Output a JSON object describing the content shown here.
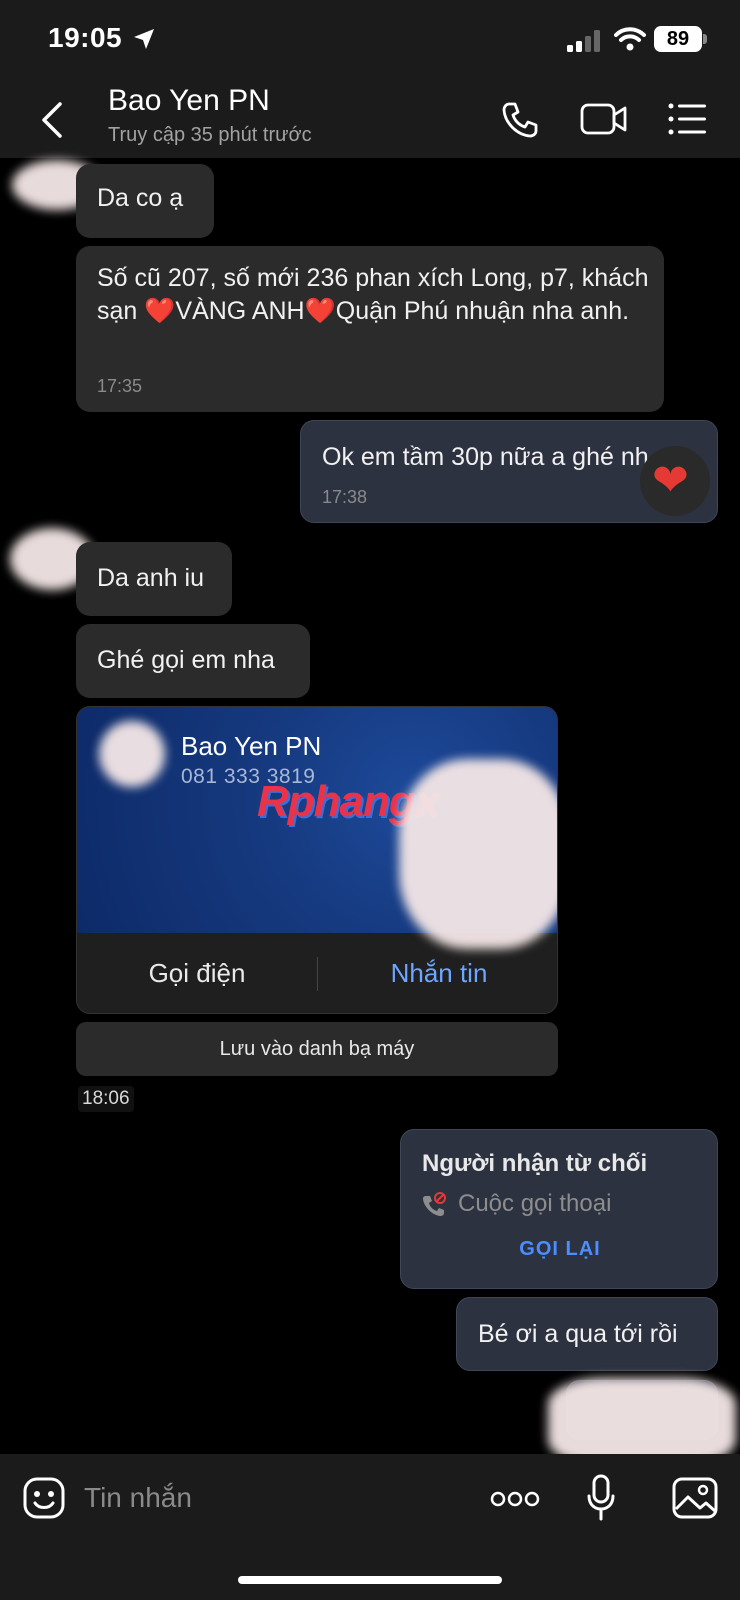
{
  "status_bar": {
    "time": "19:05",
    "battery": "89"
  },
  "header": {
    "name": "Bao Yen PN",
    "last_seen": "Truy cập 35 phút trước"
  },
  "messages": {
    "m1": "Da co ạ",
    "m2_part1": "Số cũ 207, số mới 236 phan xích Long, p7, khách sạn ",
    "m2_heart": "❤️",
    "m2_part2": "VÀNG ANH",
    "m2_part3": "Quận Phú nhuận nha anh.",
    "m2_time": "17:35",
    "m3": "Ok em tầm 30p nữa a ghé nh",
    "m3_time": "17:38",
    "m3_reaction": "❤",
    "m4": "Da anh iu",
    "m5": "Ghé gọi em nha",
    "m7": "Bé ơi a qua tới rồi"
  },
  "contact_card": {
    "name": "Bao Yen PN",
    "phone": "081 333 3819",
    "call_label": "Gọi điện",
    "message_label": "Nhắn tin",
    "save_label": "Lưu vào danh bạ máy",
    "time": "18:06",
    "watermark": "Rphangx"
  },
  "call_notice": {
    "title": "Người nhận từ chối",
    "type": "Cuộc gọi thoại",
    "action": "GỌI LẠI"
  },
  "input": {
    "placeholder": "Tin nhắn"
  },
  "colors": {
    "accent": "#4c8dff",
    "heart": "#e53935",
    "card_blue": "#163a80"
  }
}
